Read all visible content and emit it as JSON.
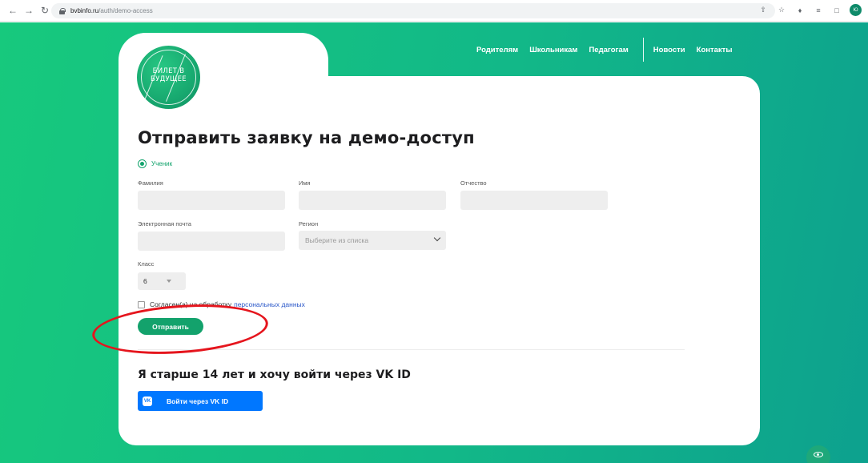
{
  "browser": {
    "url_domain": "bvbinfo.ru",
    "url_path": "/auth/demo-access"
  },
  "logo": {
    "line1": "БИЛЕТ В",
    "line2": "БУДУЩЕЕ"
  },
  "nav": {
    "items": [
      "Родителям",
      "Школьникам",
      "Педагогам"
    ],
    "secondary": [
      "Новости",
      "Контакты"
    ]
  },
  "form": {
    "title": "Отправить заявку на демо-доступ",
    "role_option": "Ученик",
    "labels": {
      "last_name": "Фамилия",
      "first_name": "Имя",
      "patronymic": "Отчество",
      "email": "Электронная почта",
      "region": "Регион",
      "class": "Класс"
    },
    "region_placeholder": "Выберите из списка",
    "class_value": "6",
    "consent_text": "Согласен(а) на обработку",
    "consent_link": "персональных данных",
    "submit_label": "Отправить"
  },
  "vk": {
    "heading": "Я старше 14 лет и хочу войти через VK ID",
    "button_label": "Войти через VK ID",
    "icon_text": "VK"
  },
  "annotation": {
    "color": "#e5151d",
    "target": "submit-button"
  },
  "colors": {
    "brand_green": "#13a26c",
    "vk_blue": "#0077ff"
  }
}
